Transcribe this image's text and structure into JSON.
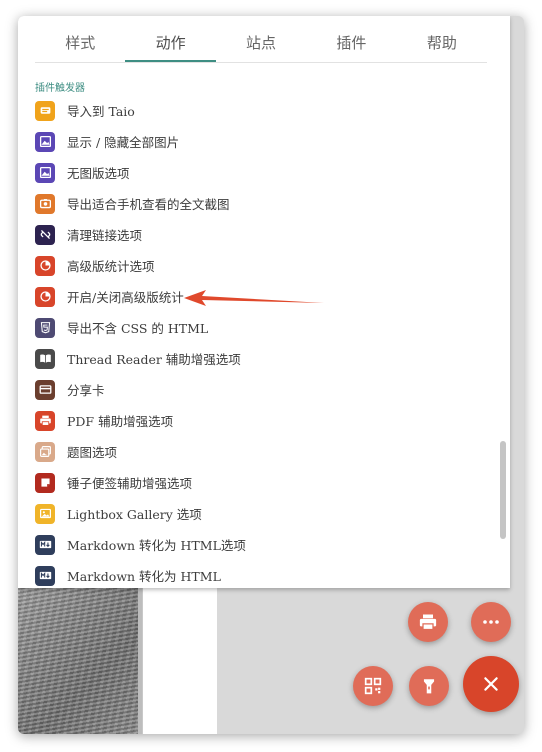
{
  "tabs": [
    {
      "label": "样式"
    },
    {
      "label": "动作"
    },
    {
      "label": "站点"
    },
    {
      "label": "插件"
    },
    {
      "label": "帮助"
    }
  ],
  "active_tab": "动作",
  "section_label": "插件触发器",
  "items": [
    {
      "label": "导入到 Taio",
      "icon": "taio-icon",
      "color": "#f0a31b"
    },
    {
      "label": "显示 / 隐藏全部图片",
      "icon": "image-icon",
      "color": "#5b47b5"
    },
    {
      "label": "无图版选项",
      "icon": "image-icon",
      "color": "#5b47b5"
    },
    {
      "label": "导出适合手机查看的全文截图",
      "icon": "camera-icon",
      "color": "#e0782b"
    },
    {
      "label": "清理链接选项",
      "icon": "link-off-icon",
      "color": "#2d2350"
    },
    {
      "label": "高级版统计选项",
      "icon": "pie-chart-icon",
      "color": "#d8452a"
    },
    {
      "label": "开启/关闭高级版统计",
      "icon": "pie-chart-icon",
      "color": "#d8452a"
    },
    {
      "label": "导出不含 CSS 的 HTML",
      "icon": "html5-icon",
      "color": "#4e4a73"
    },
    {
      "label": "Thread Reader 辅助增强选项",
      "icon": "book-icon",
      "color": "#4a4a4a"
    },
    {
      "label": "分享卡",
      "icon": "card-icon",
      "color": "#6b3e2e"
    },
    {
      "label": "PDF 辅助增强选项",
      "icon": "printer-icon",
      "color": "#d8452a"
    },
    {
      "label": "题图选项",
      "icon": "images-icon",
      "color": "#d9a98a"
    },
    {
      "label": "锤子便签辅助增强选项",
      "icon": "note-icon",
      "color": "#b22a1f"
    },
    {
      "label": "Lightbox Gallery 选项",
      "icon": "gallery-icon",
      "color": "#f0b429"
    },
    {
      "label": "Markdown 转化为 HTML选项",
      "icon": "markdown-icon",
      "color": "#2f3e5c"
    },
    {
      "label": "Markdown 转化为 HTML",
      "icon": "markdown-icon",
      "color": "#2f3e5c"
    }
  ],
  "colors": {
    "accent": "#3e8e83",
    "fab_secondary": "#e06c58",
    "fab_primary": "#d8452a",
    "annotation_arrow": "#e0492c"
  },
  "fabs": [
    {
      "icon": "printer-icon"
    },
    {
      "icon": "more-icon"
    },
    {
      "icon": "qr-code-icon"
    },
    {
      "icon": "flashlight-icon"
    },
    {
      "icon": "close-icon"
    }
  ]
}
